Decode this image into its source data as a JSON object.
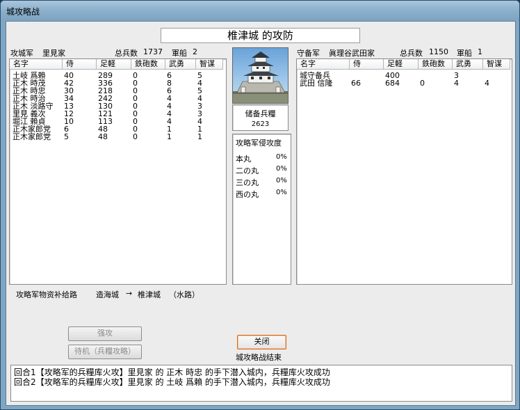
{
  "window": {
    "title": "城攻略战"
  },
  "castle_title": "椎津城 的攻防",
  "attacker": {
    "label": "攻城军",
    "clan": "里見家",
    "total_label": "总兵数",
    "total": "1737",
    "ships_label": "軍船",
    "ships": "2"
  },
  "defender": {
    "label": "守备军",
    "clan": "眞理谷武田家",
    "total_label": "总兵数",
    "total": "1150",
    "ships_label": "軍船",
    "ships": "1"
  },
  "columns": [
    "名字",
    "侍",
    "足軽",
    "鉄砲数",
    "武勇",
    "智谋"
  ],
  "attacker_rows": [
    [
      "土岐 爲賴",
      "40",
      "289",
      "0",
      "6",
      "5"
    ],
    [
      "正木 時茂",
      "42",
      "336",
      "0",
      "8",
      "4"
    ],
    [
      "正木 時忠",
      "30",
      "218",
      "0",
      "6",
      "5"
    ],
    [
      "正木 時治",
      "34",
      "242",
      "0",
      "4",
      "4"
    ],
    [
      "正木 淡路守",
      "13",
      "130",
      "0",
      "4",
      "3"
    ],
    [
      "里見 義次",
      "12",
      "121",
      "0",
      "4",
      "3"
    ],
    [
      "堀江 賴貞",
      "10",
      "113",
      "0",
      "4",
      "4"
    ],
    [
      "正木家郎党",
      "6",
      "48",
      "0",
      "1",
      "1"
    ],
    [
      "正木家郎党",
      "5",
      "48",
      "0",
      "1",
      "1"
    ]
  ],
  "defender_rows": [
    [
      "城守备兵",
      "",
      "400",
      "",
      "3",
      ""
    ],
    [
      "武田 信隆",
      "66",
      "684",
      "0",
      "4",
      "4"
    ]
  ],
  "supply": {
    "label": "储备兵糧",
    "value": "2623"
  },
  "invasion": {
    "label": "攻略军侵攻度",
    "items": [
      {
        "name": "本丸",
        "value": "0%"
      },
      {
        "name": "二の丸",
        "value": "0%"
      },
      {
        "name": "三の丸",
        "value": "0%"
      },
      {
        "name": "西の丸",
        "value": "0%"
      }
    ]
  },
  "route": {
    "label": "攻略军物资补给路",
    "from": "造海城",
    "arrow": "→",
    "to": "椎津城",
    "mode": "（水路）"
  },
  "buttons": {
    "assault": "强攻",
    "wait": "待机（兵糧攻略）",
    "close": "关闭"
  },
  "status": "城攻略战结束",
  "log": [
    "回合1【攻略军的兵糧库火攻】里見家 的 正木 時忠 的手下潜入城内，兵糧库火攻成功",
    "回合2【攻略军的兵糧库火攻】里見家 的 土岐 爲賴 的手下潜入城内，兵糧库火攻成功"
  ]
}
